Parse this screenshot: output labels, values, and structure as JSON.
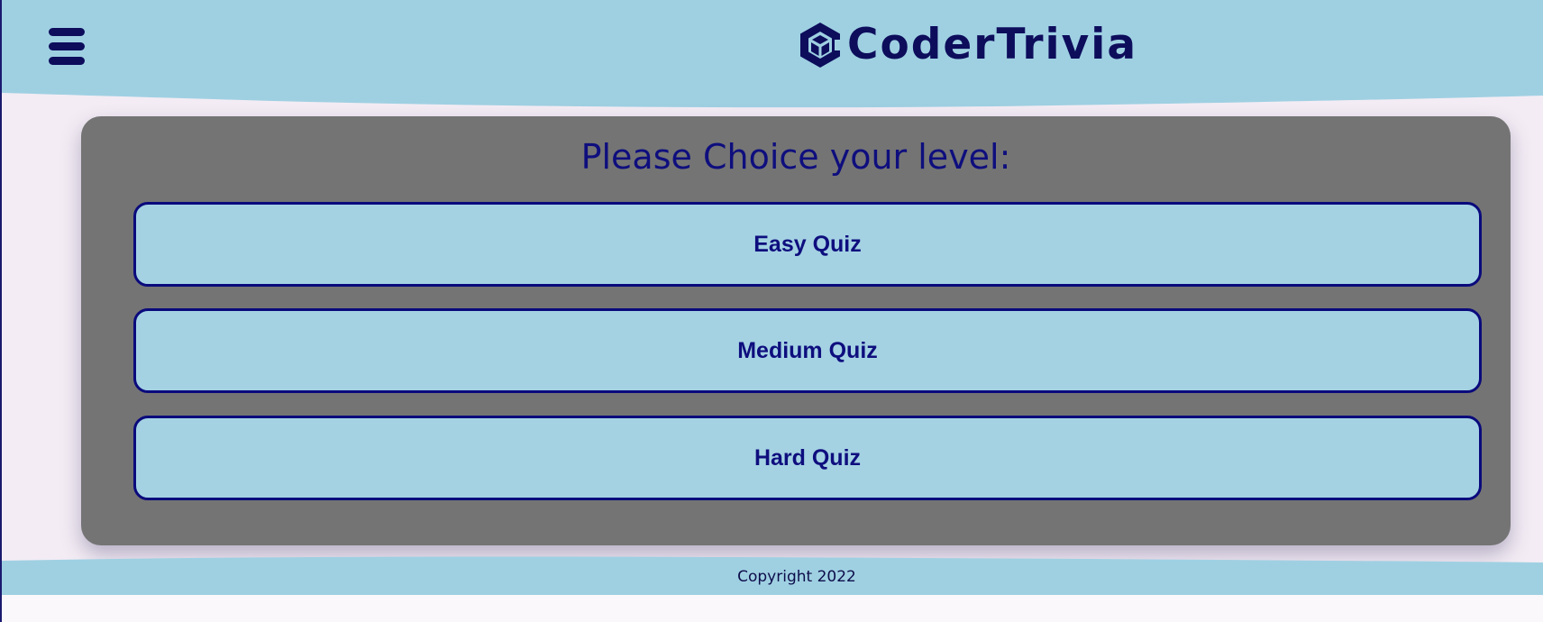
{
  "header": {
    "menu_icon": "hamburger-menu-icon",
    "logo_icon": "hexagon-cube-c-icon",
    "brand_name": "CoderTrivia"
  },
  "quiz": {
    "heading": "Please Choice your level:",
    "levels": [
      {
        "label": "Easy Quiz"
      },
      {
        "label": "Medium Quiz"
      },
      {
        "label": "Hard Quiz"
      }
    ]
  },
  "footer": {
    "copyright": "Copyright 2022"
  },
  "colors": {
    "header_bg": "#9fd0e2",
    "page_bg": "#f3ecf4",
    "card_bg": "#747474",
    "button_bg": "#a4d2e3",
    "button_border": "#0a0a7c",
    "text_navy": "#0d0d5c"
  }
}
